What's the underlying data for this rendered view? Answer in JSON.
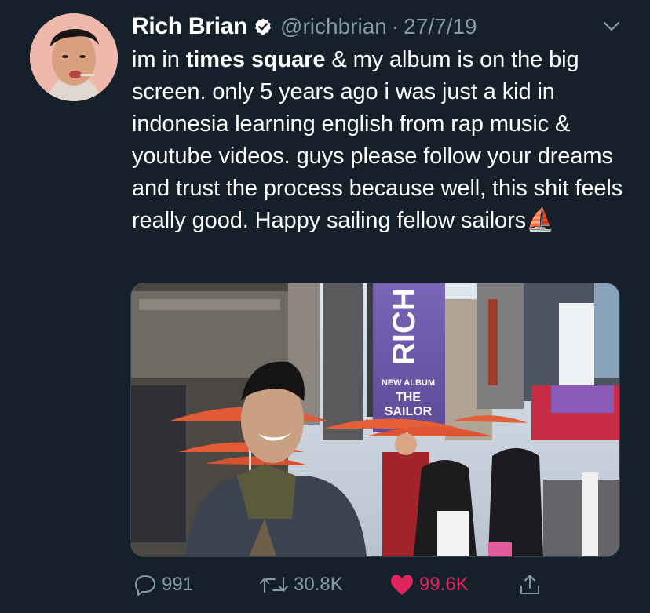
{
  "tweet": {
    "author_name": "Rich Brian",
    "handle": "@richbrian",
    "separator": "·",
    "date": "27/7/19",
    "text_parts": [
      {
        "text": "im in ",
        "bold": false
      },
      {
        "text": "times square",
        "bold": true
      },
      {
        "text": " & my album is on the big screen. only 5 years ago i was just a kid in indonesia learning english from rap music & youtube videos. guys please follow your dreams and trust the process because well, this shit feels really good. Happy sailing fellow sailors",
        "bold": false
      }
    ],
    "emoji": "⛵"
  },
  "media": {
    "billboard_word": "RICH",
    "billboard_caption": "NEW ALBUM",
    "billboard_title_1": "THE",
    "billboard_title_2": "SAILOR"
  },
  "actions": {
    "replies": "991",
    "retweets": "30.8K",
    "likes": "99.6K"
  },
  "icons": {
    "verified": "verified-badge-icon",
    "menu": "chevron-down-icon",
    "reply": "reply-bubble-icon",
    "retweet": "retweet-icon",
    "like": "heart-icon",
    "share": "share-icon"
  },
  "colors": {
    "background": "#15202b",
    "secondary_text": "#8899a6",
    "like_active": "#e0245e",
    "billboard_purple": "#6c59a8"
  }
}
